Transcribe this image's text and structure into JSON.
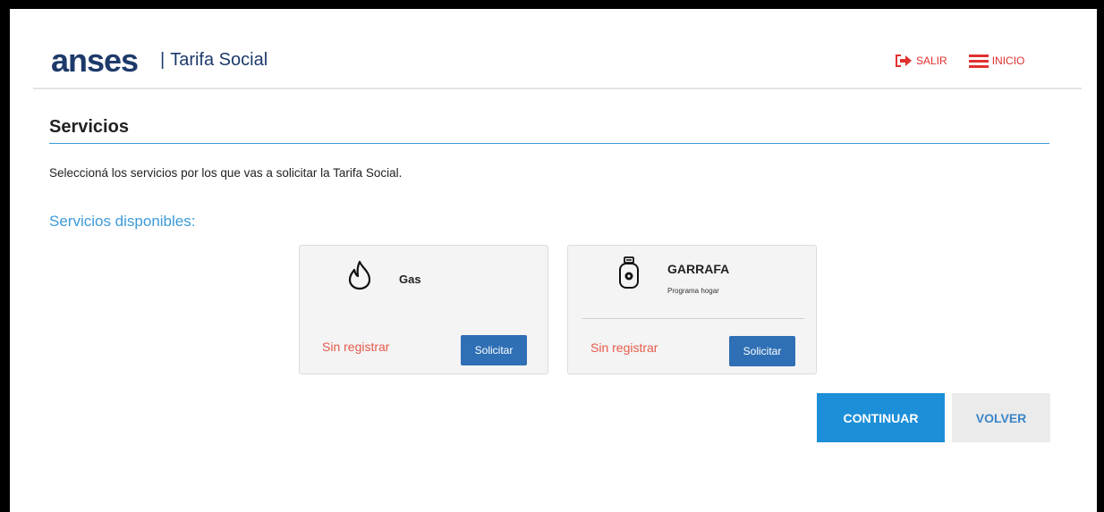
{
  "header": {
    "logo_text": "anses",
    "separator": "|",
    "app_title": "Tarifa Social",
    "salir_label": "SALIR",
    "inicio_label": "INICIO"
  },
  "section": {
    "title": "Servicios",
    "intro": "Seleccioná los servicios por los que vas a solicitar la Tarifa Social.",
    "available_label": "Servicios disponibles:"
  },
  "services": [
    {
      "name": "Gas",
      "subtitle": "",
      "status": "Sin registrar",
      "button_label": "Solicitar",
      "icon": "flame-icon"
    },
    {
      "name": "GARRAFA",
      "subtitle": "Programa hogar",
      "status": "Sin registrar",
      "button_label": "Solicitar",
      "icon": "gas-cylinder-icon"
    }
  ],
  "actions": {
    "continue_label": "CONTINUAR",
    "back_label": "VOLVER"
  },
  "colors": {
    "brand_navy": "#1d3a6a",
    "accent_blue": "#3b9ad9",
    "status_red": "#e65a4a",
    "button_blue": "#2f6fb5",
    "primary_button": "#1d8fd8"
  }
}
